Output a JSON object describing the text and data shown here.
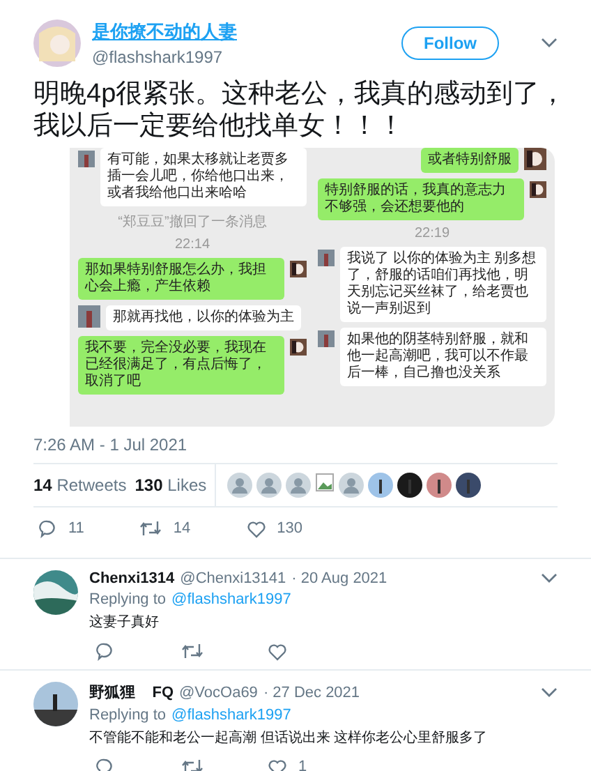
{
  "tweet": {
    "author": {
      "name": "是你撩不动的人妻",
      "handle": "@flashshark1997"
    },
    "follow_button": "Follow",
    "text_lines": [
      "明晚4p很紧张。这种老公，我真的感动到了，",
      "我以后一定要给他找单女！！！"
    ],
    "media": {
      "columns": [
        [
          {
            "kind": "received",
            "color": "#ffffff",
            "text": "有可能，如果太移就让老贾多插一会儿吧，你给他口出来，或者我给他口出来哈哈"
          },
          {
            "kind": "notice",
            "text": "“郑豆豆”撤回了一条消息"
          },
          {
            "kind": "time",
            "text": "22:14"
          },
          {
            "kind": "sent",
            "color": "#95ec69",
            "text": "那如果特别舒服怎么办，我担心会上瘾，产生依赖"
          },
          {
            "kind": "received",
            "color": "#ffffff",
            "text": "那就再找他，以你的体验为主"
          },
          {
            "kind": "sent",
            "color": "#95ec69",
            "text": "我不要，完全没必要，我现在已经很满足了，有点后悔了，取消了吧"
          }
        ],
        [
          {
            "kind": "sent",
            "color": "#95ec69",
            "text": "或者特别舒服"
          },
          {
            "kind": "sent",
            "color": "#95ec69",
            "text": "特别舒服的话，我真的意志力不够强，会还想要他的"
          },
          {
            "kind": "time",
            "text": "22:19"
          },
          {
            "kind": "received",
            "color": "#ffffff",
            "text": "我说了 以你的体验为主 别多想了，舒服的话咱们再找他，明天别忘记买丝袜了，给老贾也说一声别迟到"
          },
          {
            "kind": "received",
            "color": "#ffffff",
            "text": "如果他的阴茎特别舒服，就和他一起高潮吧，我可以不作最后一棒，自己撸也没关系"
          }
        ]
      ]
    },
    "timestamp": "7:26 AM - 1 Jul 2021",
    "stats": {
      "retweets": {
        "count": "14",
        "label": "Retweets"
      },
      "likes": {
        "count": "130",
        "label": "Likes"
      }
    },
    "likers": [
      {
        "kind": "default"
      },
      {
        "kind": "default"
      },
      {
        "kind": "default"
      },
      {
        "kind": "broken"
      },
      {
        "kind": "default"
      },
      {
        "kind": "photo",
        "color": "#9ec3e8"
      },
      {
        "kind": "photo",
        "color": "#1a1a1a"
      },
      {
        "kind": "photo",
        "color": "#d08a8a"
      },
      {
        "kind": "photo",
        "color": "#3a4a6a"
      }
    ],
    "actions": {
      "replies": "11",
      "retweets": "14",
      "likes": "130"
    }
  },
  "replies": [
    {
      "name": "Chenxi1314",
      "handle": "@Chenxi13141",
      "date": "· 20 Aug 2021",
      "replying_label": "Replying to",
      "replying_to": "@flashshark1997",
      "text": "这妻子真好"
    },
    {
      "name": "野狐狸    FQ",
      "handle": "@VocOa69",
      "date": "· 27 Dec 2021",
      "replying_label": "Replying to",
      "replying_to": "@flashshark1997",
      "text": "不管能不能和老公一起高潮 但话说出来 这样你老公心里舒服多了",
      "likes": "1"
    }
  ]
}
